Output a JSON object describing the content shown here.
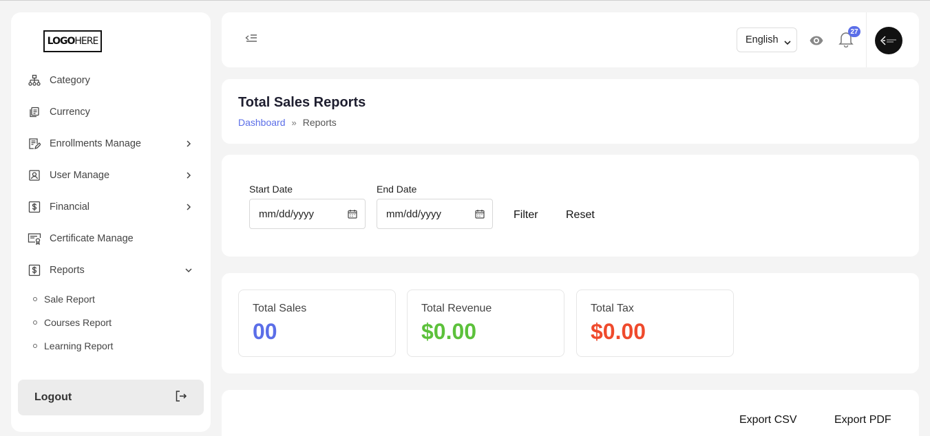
{
  "logo": {
    "bold": "LOGO",
    "light": "HERE"
  },
  "sidebar": {
    "items": [
      {
        "label": "Category"
      },
      {
        "label": "Currency"
      },
      {
        "label": "Enrollments Manage"
      },
      {
        "label": "User Manage"
      },
      {
        "label": "Financial"
      },
      {
        "label": "Certificate Manage"
      },
      {
        "label": "Reports"
      }
    ],
    "reports_sub": [
      {
        "label": "Sale Report"
      },
      {
        "label": "Courses Report"
      },
      {
        "label": "Learning Report"
      }
    ],
    "logout_label": "Logout"
  },
  "topbar": {
    "language": "English",
    "notification_count": "27"
  },
  "page": {
    "title": "Total Sales Reports",
    "breadcrumb": {
      "home": "Dashboard",
      "sep": "»",
      "current": "Reports"
    }
  },
  "filter": {
    "start_label": "Start Date",
    "start_placeholder": "mm/dd/yyyy",
    "end_label": "End Date",
    "end_placeholder": "mm/dd/yyyy",
    "filter_btn": "Filter",
    "reset_btn": "Reset"
  },
  "stats": [
    {
      "label": "Total Sales",
      "value": "00",
      "color": "#5b6ee8"
    },
    {
      "label": "Total Revenue",
      "value": "$0.00",
      "color": "#5cc13b"
    },
    {
      "label": "Total Tax",
      "value": "$0.00",
      "color": "#ef4a2c"
    }
  ],
  "export": {
    "csv": "Export CSV",
    "pdf": "Export PDF"
  }
}
